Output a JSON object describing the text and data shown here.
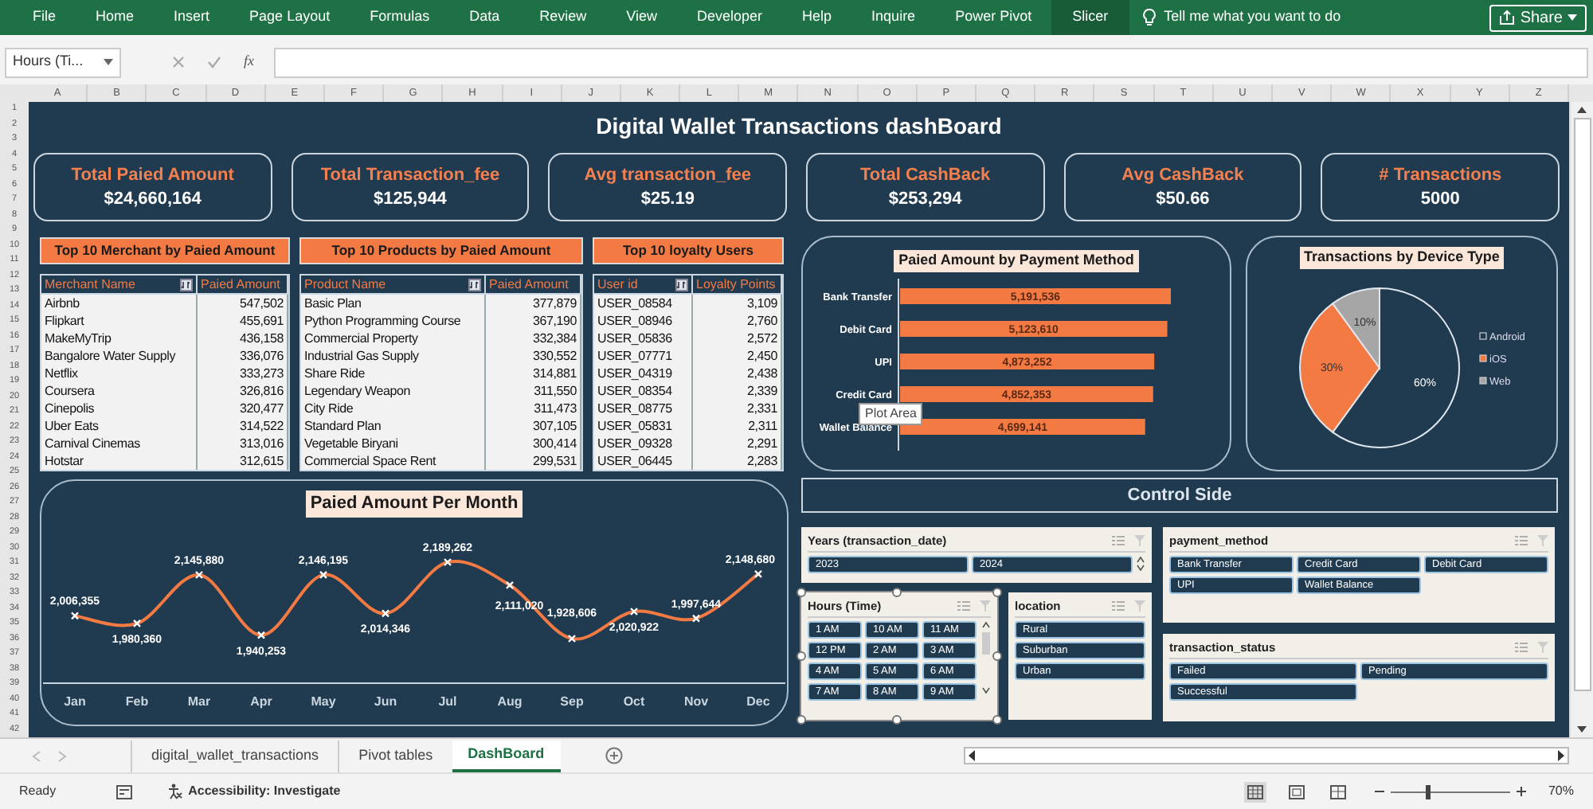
{
  "ribbon": {
    "tabs": [
      {
        "label": "File",
        "selected": false
      },
      {
        "label": "Home",
        "selected": false
      },
      {
        "label": "Insert",
        "selected": false
      },
      {
        "label": "Page Layout",
        "selected": false
      },
      {
        "label": "Formulas",
        "selected": false
      },
      {
        "label": "Data",
        "selected": false
      },
      {
        "label": "Review",
        "selected": false
      },
      {
        "label": "View",
        "selected": false
      },
      {
        "label": "Developer",
        "selected": false
      },
      {
        "label": "Help",
        "selected": false
      },
      {
        "label": "Inquire",
        "selected": false
      },
      {
        "label": "Power Pivot",
        "selected": false
      },
      {
        "label": "Slicer",
        "selected": true
      }
    ],
    "tell_me": "Tell me what you want to do",
    "share_button": "Share"
  },
  "formula_bar": {
    "name_box": "Hours (Ti...",
    "fx": "fx"
  },
  "column_headers": [
    "A",
    "B",
    "C",
    "D",
    "E",
    "F",
    "G",
    "H",
    "I",
    "J",
    "K",
    "L",
    "M",
    "N",
    "O",
    "P",
    "Q",
    "R",
    "S",
    "T",
    "U",
    "V",
    "W",
    "X",
    "Y",
    "Z"
  ],
  "row_headers": [
    "1",
    "2",
    "3",
    "4",
    "5",
    "6",
    "7",
    "8",
    "9",
    "10",
    "11",
    "12",
    "13",
    "14",
    "15",
    "16",
    "17",
    "18",
    "19",
    "20",
    "21",
    "22",
    "23",
    "24",
    "25",
    "26",
    "27",
    "28",
    "29",
    "30",
    "31",
    "32",
    "33",
    "34",
    "35",
    "36",
    "37",
    "38",
    "39",
    "40",
    "41",
    "42"
  ],
  "dashboard": {
    "title": "Digital Wallet Transactions dashBoard",
    "kpis": [
      {
        "label": "Total Paied Amount",
        "value": "$24,660,164"
      },
      {
        "label": "Total Transaction_fee",
        "value": "$125,944"
      },
      {
        "label": "Avg transaction_fee",
        "value": "$25.19"
      },
      {
        "label": "Total CashBack",
        "value": "$253,294"
      },
      {
        "label": "Avg CashBack",
        "value": "$50.66"
      },
      {
        "label": "# Transactions",
        "value": "5000"
      }
    ],
    "tables": [
      {
        "title": "Top 10 Merchant by Paied Amount",
        "columns": [
          "Merchant Name",
          "Paied Amount"
        ],
        "rows": [
          [
            "Airbnb",
            "547,502"
          ],
          [
            "Flipkart",
            "455,691"
          ],
          [
            "MakeMyTrip",
            "436,158"
          ],
          [
            "Bangalore Water Supply",
            "336,076"
          ],
          [
            "Netflix",
            "333,273"
          ],
          [
            "Coursera",
            "326,816"
          ],
          [
            "Cinepolis",
            "320,477"
          ],
          [
            "Uber Eats",
            "314,522"
          ],
          [
            "Carnival Cinemas",
            "313,016"
          ],
          [
            "Hotstar",
            "312,615"
          ]
        ]
      },
      {
        "title": "Top 10 Products by Paied Amount",
        "columns": [
          "Product Name",
          "Paied Amount"
        ],
        "rows": [
          [
            "Basic Plan",
            "377,879"
          ],
          [
            "Python Programming Course",
            "367,190"
          ],
          [
            "Commercial Property",
            "332,384"
          ],
          [
            "Industrial Gas Supply",
            "330,552"
          ],
          [
            "Share Ride",
            "314,881"
          ],
          [
            "Legendary Weapon",
            "311,550"
          ],
          [
            "City Ride",
            "311,473"
          ],
          [
            "Standard Plan",
            "307,105"
          ],
          [
            "Vegetable Biryani",
            "300,414"
          ],
          [
            "Commercial Space Rent",
            "299,531"
          ]
        ]
      },
      {
        "title": "Top 10 loyalty Users",
        "columns": [
          "User id",
          "Loyalty Points"
        ],
        "rows": [
          [
            "USER_08584",
            "3,109"
          ],
          [
            "USER_08946",
            "2,760"
          ],
          [
            "USER_05836",
            "2,572"
          ],
          [
            "USER_07771",
            "2,450"
          ],
          [
            "USER_04319",
            "2,438"
          ],
          [
            "USER_08354",
            "2,339"
          ],
          [
            "USER_08775",
            "2,331"
          ],
          [
            "USER_05831",
            "2,311"
          ],
          [
            "USER_09328",
            "2,291"
          ],
          [
            "USER_06445",
            "2,283"
          ]
        ]
      }
    ],
    "bar_chart": {
      "chart_data": {
        "type": "bar",
        "orientation": "horizontal",
        "title": "Paied Amount by Payment Method",
        "categories": [
          "Bank Transfer",
          "Debit Card",
          "UPI",
          "Credit Card",
          "Wallet Balance"
        ],
        "series": [
          {
            "color": "#f47a44",
            "values": [
              5191536,
              5123610,
              4873252,
              4852353,
              4699141
            ],
            "value_labels": [
              "5,191,536",
              "5,123,610",
              "4,873,252",
              "4,852,353",
              "4,699,141"
            ]
          }
        ]
      },
      "tooltip": "Plot Area"
    },
    "pie_chart": {
      "chart_data": {
        "type": "pie",
        "title": "Transactions by Device Type",
        "categories": [
          "Android",
          "iOS",
          "Web"
        ],
        "series": [
          {
            "values": [
              60,
              30,
              10
            ],
            "value_labels": [
              "60%",
              "30%",
              "10%"
            ]
          }
        ],
        "colors": [
          "#203a4f",
          "#f47a44",
          "#a6a6a6"
        ],
        "legend": "right"
      }
    },
    "line_chart": {
      "chart_data": {
        "type": "line",
        "title": "Paied Amount Per Month",
        "categories": [
          "Jan",
          "Feb",
          "Mar",
          "Apr",
          "May",
          "Jun",
          "Jul",
          "Aug",
          "Sep",
          "Oct",
          "Nov",
          "Dec"
        ],
        "series": [
          {
            "color": "#f47a44",
            "marker": "x",
            "values": [
              2006355,
              1980360,
              2145880,
              1940253,
              2146195,
              2014346,
              2189262,
              2111020,
              1928606,
              2020922,
              1997644,
              2148680
            ],
            "value_labels": [
              "2,006,355",
              "1,980,360",
              "2,145,880",
              "1,940,253",
              "2,146,195",
              "2,014,346",
              "2,189,262",
              "2,111,020",
              "1,928,606",
              "2,020,922",
              "1,997,644",
              "2,148,680"
            ]
          }
        ]
      }
    },
    "control_title": "Control Side",
    "slicers": [
      {
        "title": "Years (transaction_date)",
        "selected": false,
        "items": [
          {
            "label": "2023",
            "selected": true
          },
          {
            "label": "2024",
            "selected": true
          }
        ]
      },
      {
        "title": "payment_method",
        "selected": false,
        "items": [
          {
            "label": "Bank Transfer",
            "selected": true
          },
          {
            "label": "Credit Card",
            "selected": true
          },
          {
            "label": "Debit Card",
            "selected": true
          },
          {
            "label": "UPI",
            "selected": true
          },
          {
            "label": "Wallet Balance",
            "selected": true
          }
        ]
      },
      {
        "title": "Hours (Time)",
        "selected": true,
        "items": [
          {
            "label": "1 AM",
            "selected": true
          },
          {
            "label": "10 AM",
            "selected": true
          },
          {
            "label": "11 AM",
            "selected": true
          },
          {
            "label": "12 PM",
            "selected": true
          },
          {
            "label": "2 AM",
            "selected": true
          },
          {
            "label": "3 AM",
            "selected": true
          },
          {
            "label": "4 AM",
            "selected": true
          },
          {
            "label": "5 AM",
            "selected": true
          },
          {
            "label": "6 AM",
            "selected": true
          },
          {
            "label": "7 AM",
            "selected": true
          },
          {
            "label": "8 AM",
            "selected": true
          },
          {
            "label": "9 AM",
            "selected": true
          }
        ]
      },
      {
        "title": "location",
        "selected": false,
        "items": [
          {
            "label": "Rural",
            "selected": true
          },
          {
            "label": "Suburban",
            "selected": true
          },
          {
            "label": "Urban",
            "selected": true
          }
        ]
      },
      {
        "title": "transaction_status",
        "selected": false,
        "items": [
          {
            "label": "Failed",
            "selected": true
          },
          {
            "label": "Pending",
            "selected": true
          },
          {
            "label": "Successful",
            "selected": true
          }
        ]
      }
    ]
  },
  "sheet_tabs": [
    {
      "label": "digital_wallet_transactions",
      "selected": false
    },
    {
      "label": "Pivot tables",
      "selected": false
    },
    {
      "label": "DashBoard",
      "selected": true
    }
  ],
  "status_bar": {
    "ready": "Ready",
    "accessibility": "Accessibility: Investigate",
    "zoom_slider": {
      "level": 0.3
    },
    "zoom": "70%"
  }
}
